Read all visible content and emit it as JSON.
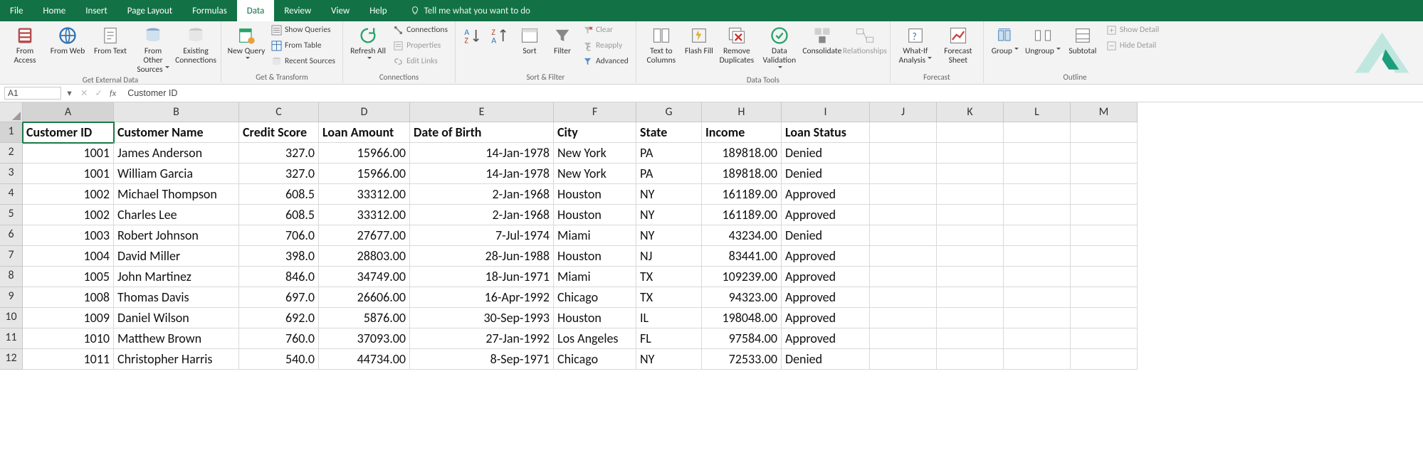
{
  "menu": {
    "items": [
      "File",
      "Home",
      "Insert",
      "Page Layout",
      "Formulas",
      "Data",
      "Review",
      "View",
      "Help"
    ],
    "active_index": 5,
    "tell_me": "Tell me what you want to do"
  },
  "ribbon": {
    "groups": {
      "get_external_data": {
        "label": "Get External Data",
        "from_access": "From\nAccess",
        "from_web": "From\nWeb",
        "from_text": "From\nText",
        "from_other": "From Other\nSources",
        "existing": "Existing\nConnections"
      },
      "get_transform": {
        "label": "Get & Transform",
        "new_query": "New\nQuery",
        "show_queries": "Show Queries",
        "from_table": "From Table",
        "recent_sources": "Recent Sources"
      },
      "connections": {
        "label": "Connections",
        "refresh_all": "Refresh\nAll",
        "connections": "Connections",
        "properties": "Properties",
        "edit_links": "Edit Links"
      },
      "sort_filter": {
        "label": "Sort & Filter",
        "sort": "Sort",
        "filter": "Filter",
        "clear": "Clear",
        "reapply": "Reapply",
        "advanced": "Advanced"
      },
      "data_tools": {
        "label": "Data Tools",
        "text_to_columns": "Text to\nColumns",
        "flash_fill": "Flash\nFill",
        "remove_dup": "Remove\nDuplicates",
        "data_validation": "Data\nValidation",
        "consolidate": "Consolidate",
        "relationships": "Relationships"
      },
      "forecast": {
        "label": "Forecast",
        "what_if": "What-If\nAnalysis",
        "forecast_sheet": "Forecast\nSheet"
      },
      "outline": {
        "label": "Outline",
        "group": "Group",
        "ungroup": "Ungroup",
        "subtotal": "Subtotal",
        "show_detail": "Show Detail",
        "hide_detail": "Hide Detail"
      }
    }
  },
  "formula_bar": {
    "name_box": "A1",
    "value": "Customer ID"
  },
  "sheet": {
    "col_letters": [
      "A",
      "B",
      "C",
      "D",
      "E",
      "F",
      "G",
      "H",
      "I",
      "J",
      "K",
      "L",
      "M"
    ],
    "row_numbers": [
      "1",
      "2",
      "3",
      "4",
      "5",
      "6",
      "7",
      "8",
      "9",
      "10",
      "11",
      "12"
    ],
    "selected_cell": {
      "row": 0,
      "col": 0
    },
    "headers": [
      "Customer ID",
      "Customer Name",
      "Credit Score",
      "Loan Amount",
      "Date of Birth",
      "City",
      "State",
      "Income",
      "Loan Status"
    ],
    "col_align": [
      "num",
      "",
      "num",
      "num",
      "num",
      "",
      "",
      "num",
      ""
    ],
    "rows": [
      [
        "1001",
        "James Anderson",
        "327.0",
        "15966.00",
        "14-Jan-1978",
        "New York",
        "PA",
        "189818.00",
        "Denied"
      ],
      [
        "1001",
        "William Garcia",
        "327.0",
        "15966.00",
        "14-Jan-1978",
        "New York",
        "PA",
        "189818.00",
        "Denied"
      ],
      [
        "1002",
        "Michael Thompson",
        "608.5",
        "33312.00",
        "2-Jan-1968",
        "Houston",
        "NY",
        "161189.00",
        "Approved"
      ],
      [
        "1002",
        "Charles Lee",
        "608.5",
        "33312.00",
        "2-Jan-1968",
        "Houston",
        "NY",
        "161189.00",
        "Approved"
      ],
      [
        "1003",
        "Robert Johnson",
        "706.0",
        "27677.00",
        "7-Jul-1974",
        "Miami",
        "NY",
        "43234.00",
        "Denied"
      ],
      [
        "1004",
        "David Miller",
        "398.0",
        "28803.00",
        "28-Jun-1988",
        "Houston",
        "NJ",
        "83441.00",
        "Approved"
      ],
      [
        "1005",
        "John Martinez",
        "846.0",
        "34749.00",
        "18-Jun-1971",
        "Miami",
        "TX",
        "109239.00",
        "Approved"
      ],
      [
        "1008",
        "Thomas Davis",
        "697.0",
        "26606.00",
        "16-Apr-1992",
        "Chicago",
        "TX",
        "94323.00",
        "Approved"
      ],
      [
        "1009",
        "Daniel Wilson",
        "692.0",
        "5876.00",
        "30-Sep-1993",
        "Houston",
        "IL",
        "198048.00",
        "Approved"
      ],
      [
        "1010",
        "Matthew Brown",
        "760.0",
        "37093.00",
        "27-Jan-1992",
        "Los Angeles",
        "FL",
        "97584.00",
        "Approved"
      ],
      [
        "1011",
        "Christopher Harris",
        "540.0",
        "44734.00",
        "8-Sep-1971",
        "Chicago",
        "NY",
        "72533.00",
        "Denied"
      ]
    ]
  }
}
